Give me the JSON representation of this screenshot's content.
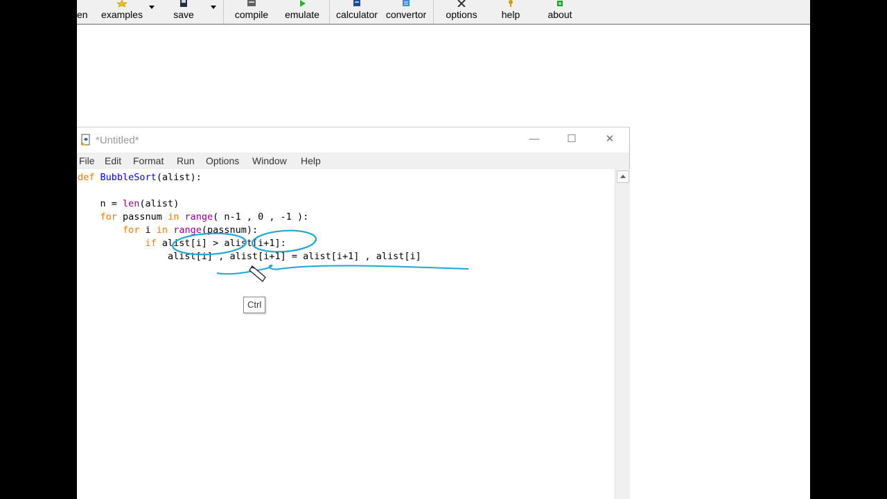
{
  "toolbar": {
    "items": [
      {
        "label": "en",
        "icon": "open-icon"
      },
      {
        "label": "examples",
        "icon": "star-icon"
      },
      {
        "label": "save",
        "icon": "floppy-icon"
      },
      {
        "label": "compile",
        "icon": "compile-icon"
      },
      {
        "label": "emulate",
        "icon": "play-icon"
      },
      {
        "label": "calculator",
        "icon": "calculator-icon"
      },
      {
        "label": "convertor",
        "icon": "convertor-icon"
      },
      {
        "label": "options",
        "icon": "tools-icon"
      },
      {
        "label": "help",
        "icon": "help-icon"
      },
      {
        "label": "about",
        "icon": "chip-icon"
      }
    ]
  },
  "window": {
    "title": "*Untitled*",
    "controls": {
      "minimize": "—",
      "maximize": "☐",
      "close": "✕"
    }
  },
  "menu": [
    "File",
    "Edit",
    "Format",
    "Run",
    "Options",
    "Window",
    "Help"
  ],
  "code": {
    "l1_kw": "def",
    "l1_name": "BubbleSort",
    "l1_rest": "(alist):",
    "l3_pre": "    n = ",
    "l3_bi": "len",
    "l3_rest": "(alist)",
    "l4_kw": "    for",
    "l4_mid": " passnum ",
    "l4_kw2": "in",
    "l4_sp": " ",
    "l4_bi": "range",
    "l4_rest": "( n-1 , 0 , -1 ):",
    "l5_kw": "        for",
    "l5_mid": " i ",
    "l5_kw2": "in",
    "l5_sp": " ",
    "l5_bi": "range",
    "l5_rest": "(passnum):",
    "l6_kw": "            if",
    "l6_rest": " alist[i] > alist[i+1]:",
    "l7": "                alist[i] , alist[i+1] = alist[i+1] , alist[i]"
  },
  "tooltip": "Ctrl",
  "colors": {
    "annotation": "#1aa7d6",
    "keyword": "#ff7700",
    "builtin": "#900090",
    "defname": "#0000ff"
  }
}
